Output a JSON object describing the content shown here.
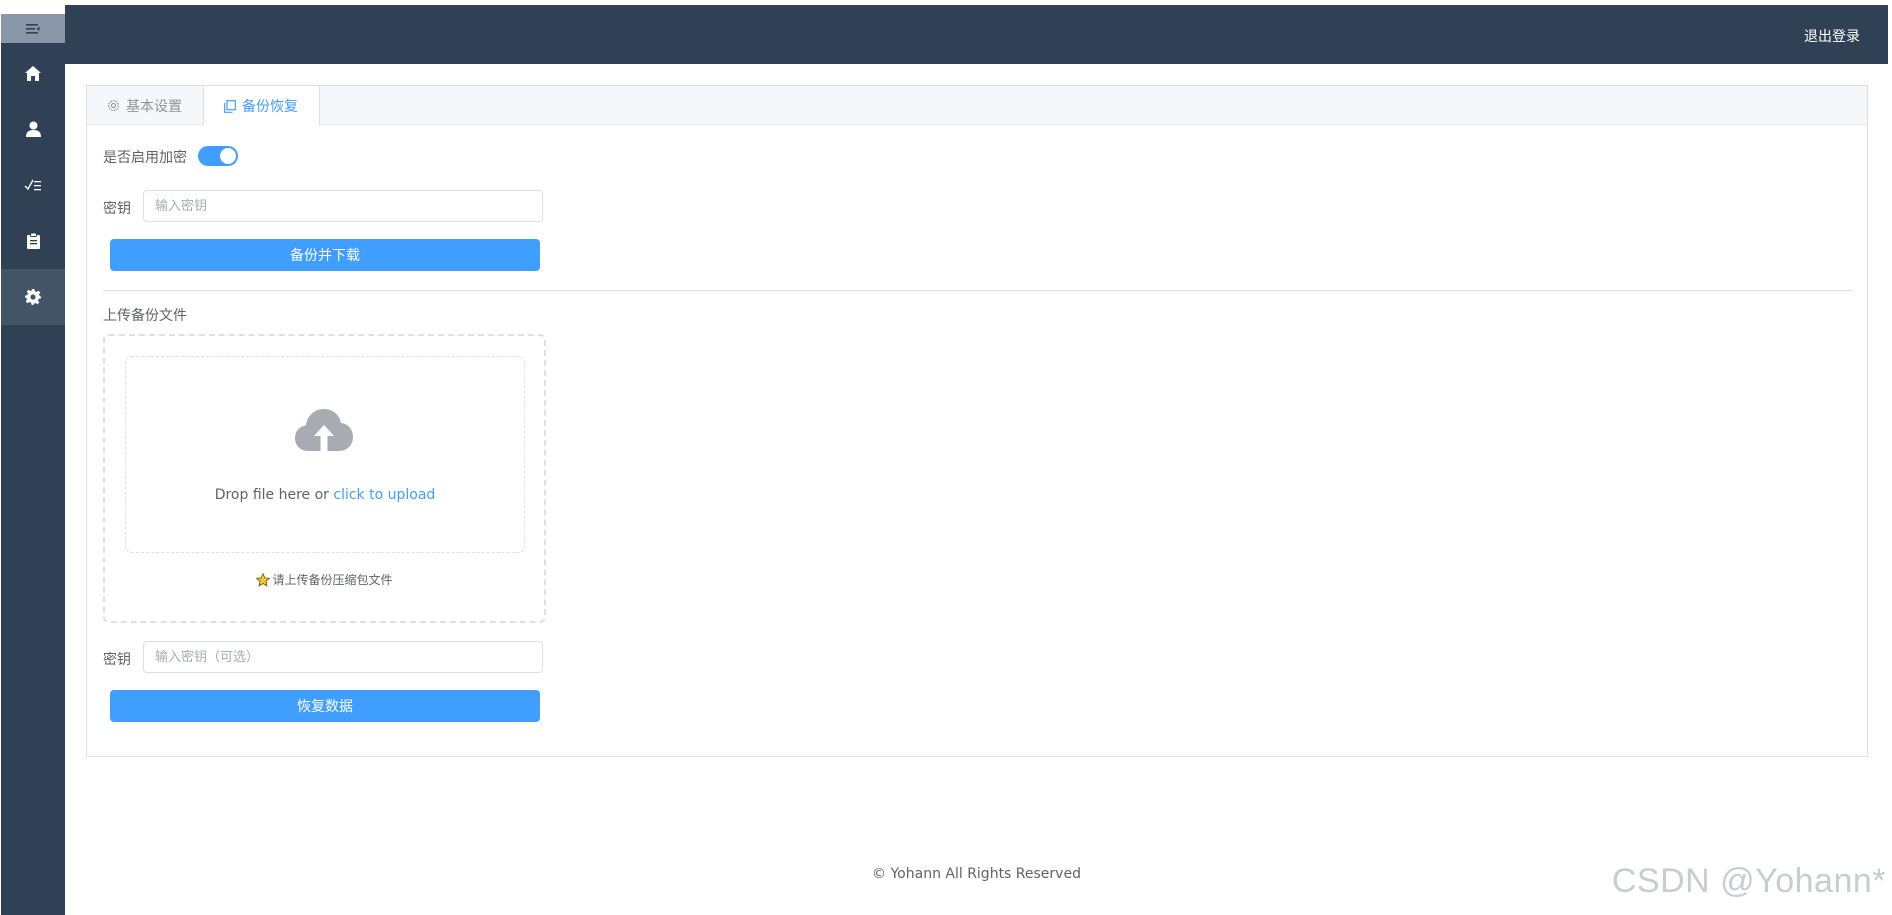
{
  "header": {
    "logout_label": "退出登录"
  },
  "sidebar": {
    "items": [
      {
        "icon": "home-icon"
      },
      {
        "icon": "user-icon"
      },
      {
        "icon": "checklist-icon"
      },
      {
        "icon": "clipboard-icon"
      },
      {
        "icon": "gear-icon",
        "active": true
      }
    ]
  },
  "tabs": [
    {
      "label": "基本设置",
      "icon": "gear-icon",
      "active": false
    },
    {
      "label": "备份恢复",
      "icon": "copy-icon",
      "active": true
    }
  ],
  "backup": {
    "encrypt_label": "是否启用加密",
    "encrypt_enabled": true,
    "key_label": "密钥",
    "key_placeholder": "输入密钥",
    "button_label": "备份并下载"
  },
  "restore": {
    "upload_title": "上传备份文件",
    "drop_text": "Drop file here or ",
    "click_text": "click to upload",
    "tip": "请上传备份压缩包文件",
    "key_label": "密钥",
    "key_placeholder": "输入密钥（可选）",
    "button_label": "恢复数据"
  },
  "footer": {
    "text": "© Yohann All Rights Reserved"
  },
  "watermark": "CSDN @Yohann*",
  "colors": {
    "sidebar": "#304156",
    "primary": "#409eff"
  }
}
